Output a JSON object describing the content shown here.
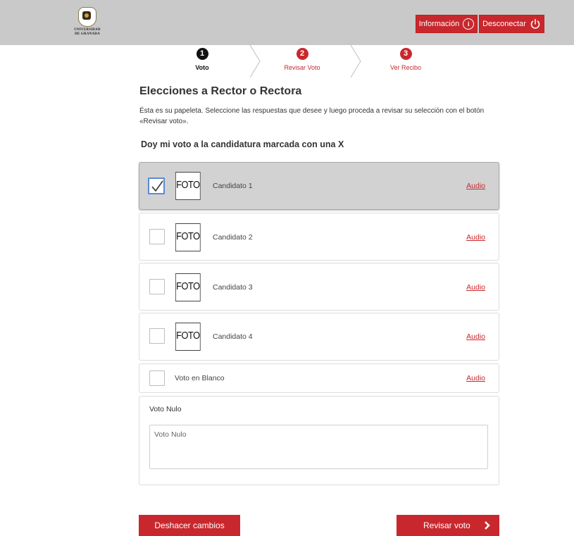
{
  "header": {
    "logo_text_line1": "UNIVERSIDAD",
    "logo_text_line2": "DE GRANADA",
    "info_label": "Información",
    "info_icon": "info-icon",
    "logout_label": "Desconectar",
    "logout_icon": "power-icon",
    "brand_color": "#c8282d"
  },
  "steps": [
    {
      "number": "1",
      "label": "Voto",
      "state": "active"
    },
    {
      "number": "2",
      "label": "Revisar Voto",
      "state": "pending"
    },
    {
      "number": "3",
      "label": "Ver Recibo",
      "state": "pending"
    }
  ],
  "ballot": {
    "title": "Elecciones a Rector o Rectora",
    "description": "Ésta es su papeleta. Seleccione las respuestas que desee y luego proceda a revisar su selección con el botón «Revisar voto».",
    "question": "Doy mi voto a la candidatura marcada con una X",
    "options": [
      {
        "photo_label": "FOTO",
        "name": "Candidato 1",
        "audio_label": "Audio",
        "checked": true
      },
      {
        "photo_label": "FOTO",
        "name": "Candidato 2",
        "audio_label": "Audio",
        "checked": false
      },
      {
        "photo_label": "FOTO",
        "name": "Candidato 3",
        "audio_label": "Audio",
        "checked": false
      },
      {
        "photo_label": "FOTO",
        "name": "Candidato 4",
        "audio_label": "Audio",
        "checked": false
      }
    ],
    "blank": {
      "name": "Voto en Blanco",
      "audio_label": "Audio",
      "checked": false
    },
    "null_vote": {
      "label": "Voto Nulo",
      "placeholder": "Voto Nulo",
      "value": ""
    }
  },
  "actions": {
    "undo_label": "Deshacer cambios",
    "review_label": "Revisar voto",
    "review_icon": "chevron-right-icon"
  }
}
